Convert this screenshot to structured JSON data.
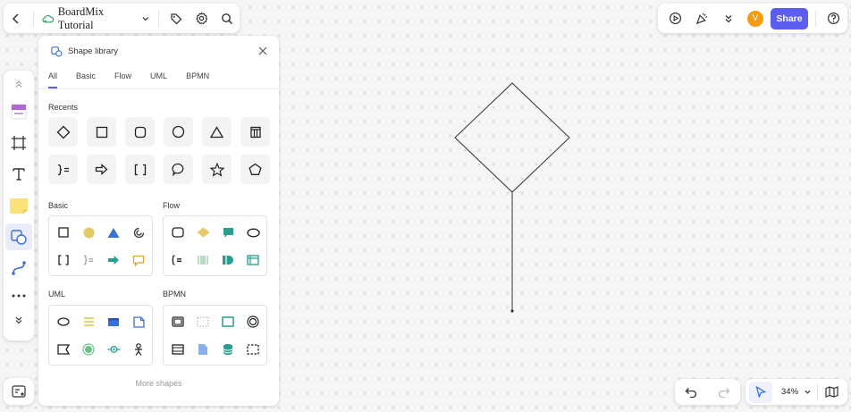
{
  "header": {
    "doc_title": "BoardMix Tutorial"
  },
  "topright": {
    "avatar_initial": "V",
    "share_label": "Share"
  },
  "library": {
    "title": "Shape library",
    "tabs": [
      "All",
      "Basic",
      "Flow",
      "UML",
      "BPMN"
    ],
    "active_tab": "All",
    "recents_title": "Recents",
    "basic_title": "Basic",
    "flow_title": "Flow",
    "uml_title": "UML",
    "bpmn_title": "BPMN",
    "more_label": "More shapes"
  },
  "zoom": {
    "level": "34%"
  },
  "colors": {
    "accent": "#5b5cf0",
    "avatar": "#f39c12",
    "basic_circle": "#e3c96a",
    "basic_triangle": "#3a6fd6",
    "teal": "#2a9d8f",
    "orange": "#e0a12c",
    "uml_yellow": "#e0c64a",
    "uml_blue": "#3a6fd6",
    "green": "#6cc28a"
  }
}
